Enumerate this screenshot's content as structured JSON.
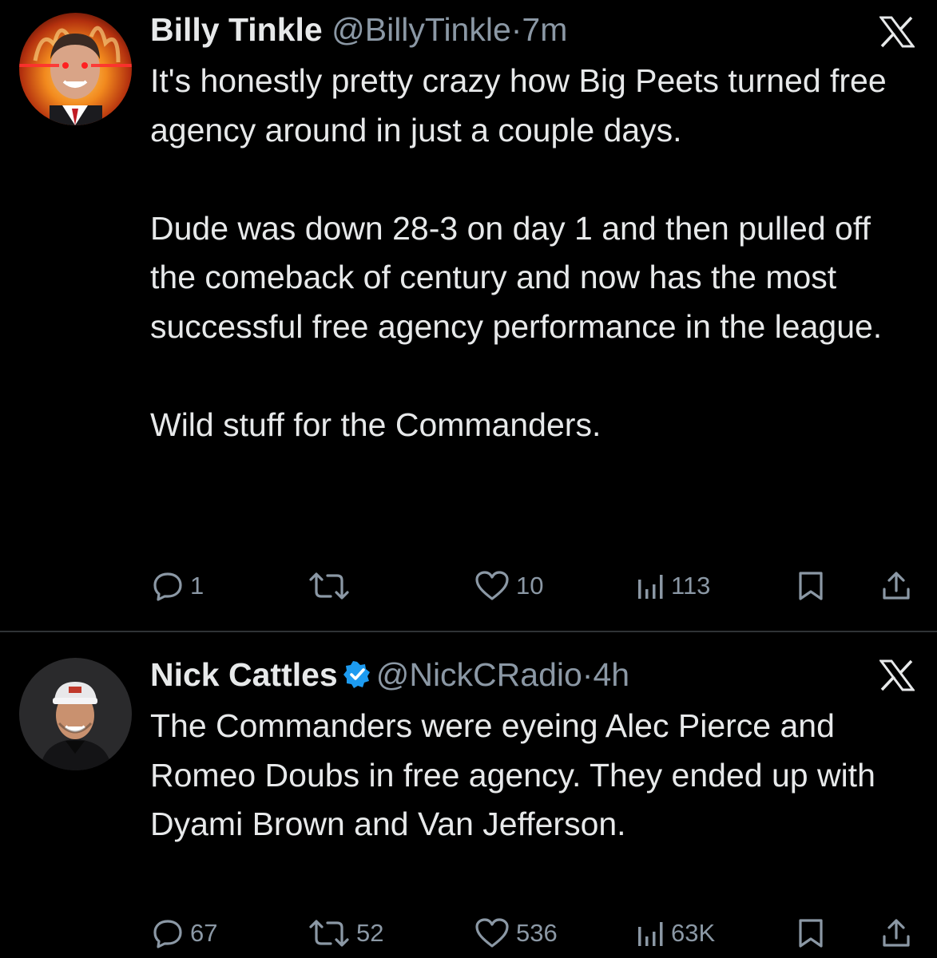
{
  "tweets": [
    {
      "name": "Billy Tinkle",
      "handle": "@BillyTinkle",
      "separator": "·",
      "time": "7m",
      "text_paragraphs": [
        "It's honestly pretty crazy how Big Peets turned free agency around in just a couple days.",
        "Dude was down 28-3 on day 1 and then pulled off the comeback of century and now has the most successful free agency performance in the league.",
        "Wild stuff for the Commanders."
      ],
      "replies": "1",
      "reposts": "",
      "likes": "10",
      "views": "113",
      "verified": false
    },
    {
      "name": "Nick Cattles",
      "handle": "@NickCRadio",
      "separator": "·",
      "time": "4h",
      "text_paragraphs": [
        "The Commanders were eyeing Alec Pierce and Romeo Doubs in free agency. They ended up with Dyami Brown and Van Jefferson."
      ],
      "replies": "67",
      "reposts": "52",
      "likes": "536",
      "views": "63K",
      "verified": true
    }
  ],
  "icons": {
    "close": "x-logo-icon",
    "reply": "reply-icon",
    "repost": "repost-icon",
    "like": "heart-icon",
    "views": "views-icon",
    "bookmark": "bookmark-icon",
    "share": "share-icon",
    "verified": "verified-badge-icon"
  },
  "colors": {
    "background": "#000000",
    "text": "#e7e9ea",
    "secondary": "#8b98a5",
    "divider": "#2f3336",
    "verified": "#1d9bf0"
  }
}
